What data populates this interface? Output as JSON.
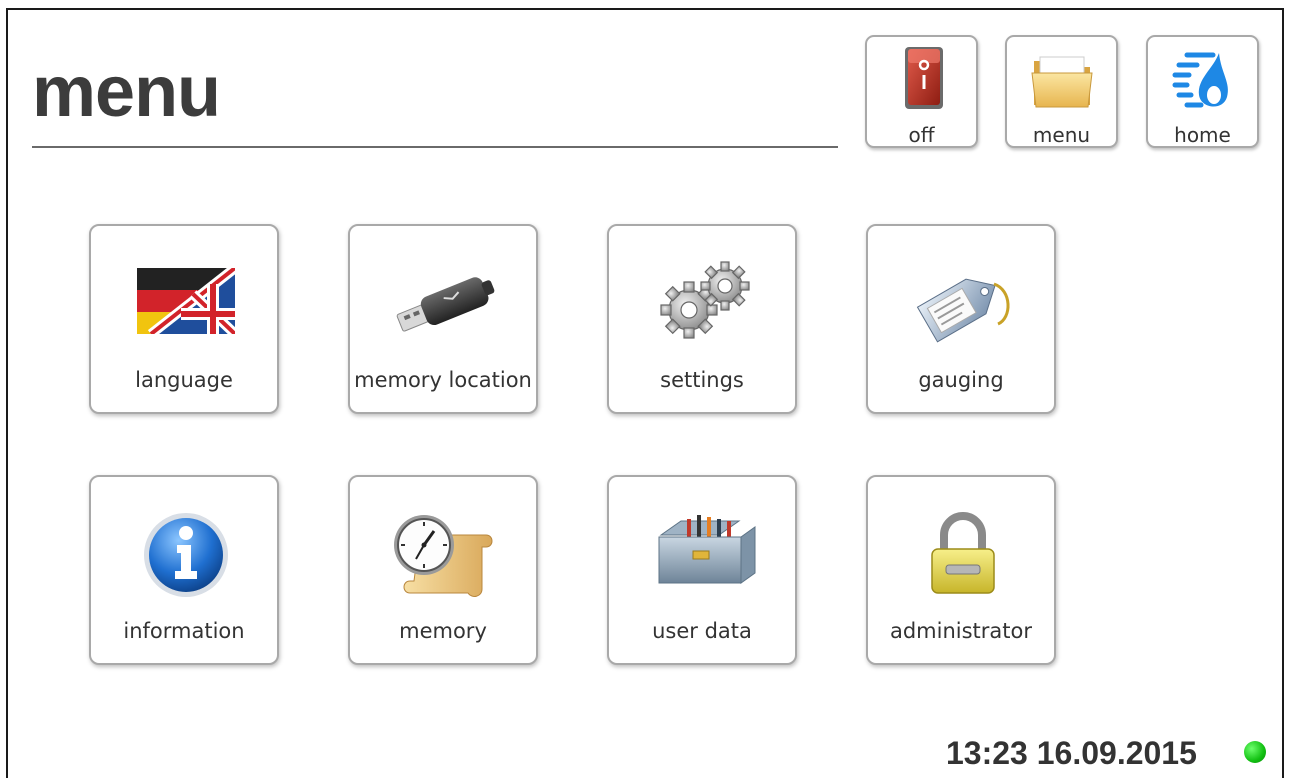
{
  "header": {
    "title": "menu"
  },
  "toolbar": {
    "off_label": "off",
    "menu_label": "menu",
    "home_label": "home"
  },
  "tiles": [
    {
      "label": "language",
      "icon": "flag-de-uk-icon"
    },
    {
      "label": "memory location",
      "icon": "usb-stick-icon"
    },
    {
      "label": "settings",
      "icon": "gears-icon"
    },
    {
      "label": "gauging",
      "icon": "tag-icon"
    },
    {
      "label": "information",
      "icon": "info-icon"
    },
    {
      "label": "memory",
      "icon": "clock-scroll-icon"
    },
    {
      "label": "user data",
      "icon": "toolbox-icon"
    },
    {
      "label": "administrator",
      "icon": "padlock-icon"
    }
  ],
  "status": {
    "datetime": "13:23 16.09.2015",
    "indicator_color": "#12c012"
  },
  "colors": {
    "border": "#a9a9a9",
    "title": "#3c3c3c",
    "off_switch": "#c0392b",
    "home_logo": "#1e88e5"
  }
}
